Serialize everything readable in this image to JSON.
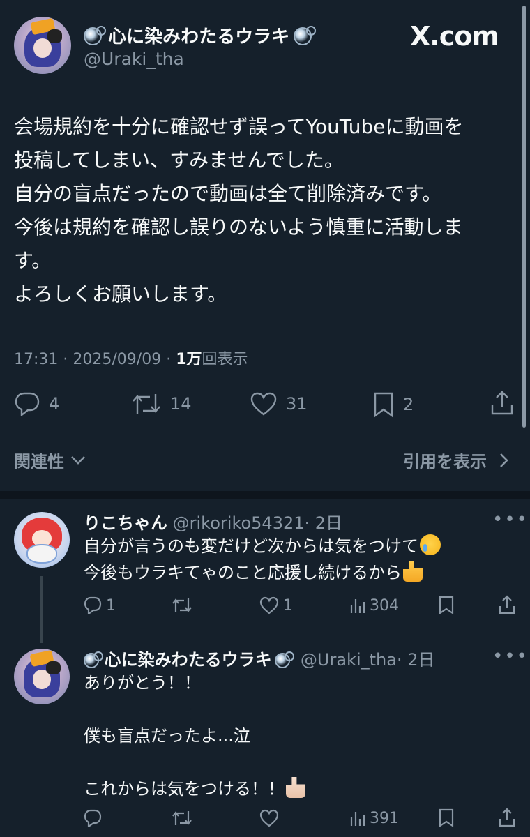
{
  "main_tweet": {
    "display_name": "心に染みわたるウラキ",
    "handle": "@Uraki_tha",
    "brand": "X.com",
    "text_lines": [
      "会場規約を十分に確認せず誤ってYouTubeに動画を",
      "投稿してしまい、すみませんでした。",
      "自分の盲点だったので動画は全て削除済みです。",
      "今後は規約を確認し誤りのないよう慎重に活動しま",
      "す。",
      "よろしくお願いします。"
    ],
    "time": "17:31",
    "date": "2025/09/09",
    "views_count": "1万",
    "views_label": "回表示",
    "sep": " · ",
    "actions": {
      "replies": "4",
      "retweets": "14",
      "likes": "31",
      "bookmarks": "2"
    },
    "relevance_label": "関連性",
    "quotes_label": "引用を表示"
  },
  "replies": [
    {
      "display_name": "りこちゃん",
      "handle": "@rikoriko54321",
      "age": "· 2日",
      "more": "•••",
      "lines": [
        "自分が言うのも変だけど次からは気をつけて",
        "今後もウラキてゃのこと応援し続けるから"
      ],
      "emojis": [
        "crying-face",
        "thumbs-up"
      ],
      "replies": "1",
      "retweets": "",
      "likes": "1",
      "views": "304"
    },
    {
      "display_name": "心に染みわたるウラキ",
      "handle": "@Uraki_tha",
      "age": "· 2日",
      "more": "•••",
      "lines": [
        "ありがとう！！",
        "僕も盲点だったよ...泣",
        "これからは気をつける！！"
      ],
      "emojis": [
        "thumbs-up-light-skin"
      ],
      "replies": "",
      "retweets": "",
      "likes": "",
      "views": "391"
    }
  ],
  "colors": {
    "background": "#15202b",
    "text": "#f7f9f9",
    "muted": "#8b98a5",
    "divider": "#0e151d"
  }
}
